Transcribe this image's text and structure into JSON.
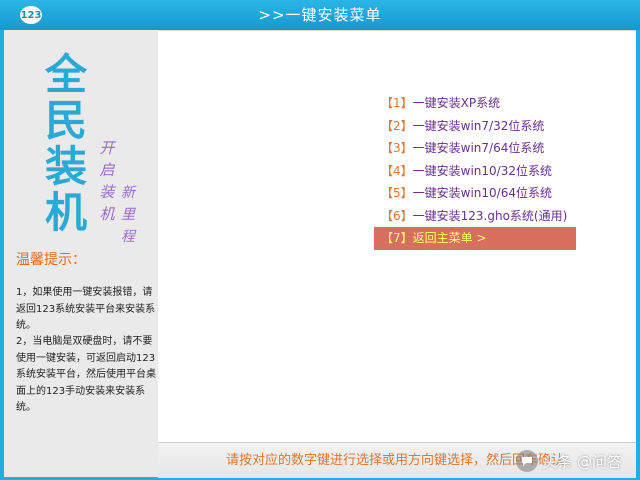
{
  "titlebar": {
    "badge": "123",
    "title": ">>一键安装菜单"
  },
  "logo": {
    "big": [
      "全",
      "民",
      "装",
      "机"
    ],
    "slogan": [
      "开",
      "启",
      "装",
      "机"
    ],
    "slogan2": [
      "新",
      "里",
      "程"
    ]
  },
  "tips": {
    "title": "温馨提示：",
    "items": [
      "1，如果使用一键安装报错，请返回123系统安装平台来安装系统。",
      "2，当电脑是双硬盘时，请不要使用一键安装，可返回启动123系统安装平台，然后使用平台桌面上的123手动安装来安装系统。"
    ]
  },
  "menu": {
    "items": [
      {
        "num": "【1】",
        "label": "一键安装XP系统",
        "selected": false
      },
      {
        "num": "【2】",
        "label": "一键安装win7/32位系统",
        "selected": false
      },
      {
        "num": "【3】",
        "label": "一键安装win7/64位系统",
        "selected": false
      },
      {
        "num": "【4】",
        "label": "一键安装win10/32位系统",
        "selected": false
      },
      {
        "num": "【5】",
        "label": "一键安装win10/64位系统",
        "selected": false
      },
      {
        "num": "【6】",
        "label": "一键安装123.gho系统(通用)",
        "selected": false
      },
      {
        "num": "【7】",
        "label": "返回主菜单  >",
        "selected": true
      }
    ]
  },
  "status": {
    "text": "请按对应的数字键进行选择或用方向键选择，然后回车确认"
  },
  "watermark": {
    "text": "头条 @问答",
    "icon": "chat-bubble-icon"
  },
  "colors": {
    "accent": "#22aee4",
    "selected_bg": "#d76f5e",
    "selected_text": "#ffff66",
    "menu_text": "#6a2f8f",
    "number_text": "#e0762f"
  }
}
